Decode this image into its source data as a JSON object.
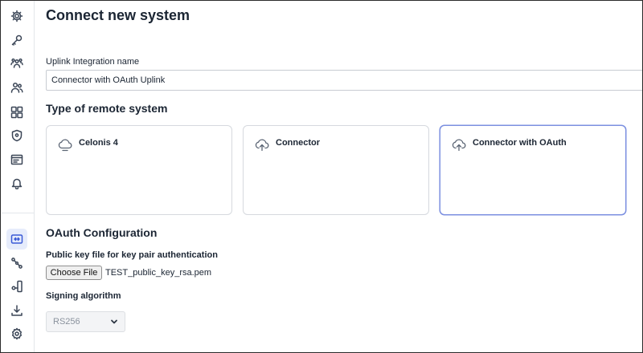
{
  "page": {
    "title": "Connect new system"
  },
  "sidebar": {
    "items": [
      {
        "icon": "gear-icon"
      },
      {
        "icon": "key-icon"
      },
      {
        "icon": "team-icon"
      },
      {
        "icon": "users-icon"
      },
      {
        "icon": "apps-icon"
      },
      {
        "icon": "shield-icon"
      },
      {
        "icon": "list-panel-icon"
      },
      {
        "icon": "bell-icon"
      },
      {
        "icon": "connection-icon",
        "active": true
      },
      {
        "icon": "nodes-icon"
      },
      {
        "icon": "device-icon"
      },
      {
        "icon": "download-icon"
      },
      {
        "icon": "settings-cog-icon"
      }
    ]
  },
  "integration": {
    "label": "Uplink Integration name",
    "value": "Connector with OAuth Uplink"
  },
  "remote_system": {
    "title": "Type of remote system",
    "options": [
      {
        "label": "Celonis 4",
        "icon": "cloud-icon"
      },
      {
        "label": "Connector",
        "icon": "cloud-upload-icon"
      },
      {
        "label": "Connector with OAuth",
        "icon": "cloud-upload-icon",
        "selected": true
      }
    ]
  },
  "oauth": {
    "title": "OAuth Configuration",
    "key_file_label": "Public key file for key pair authentication",
    "choose_file_label": "Choose File",
    "file_name": "TEST_public_key_rsa.pem",
    "signing_label": "Signing algorithm",
    "signing_value": "RS256"
  }
}
